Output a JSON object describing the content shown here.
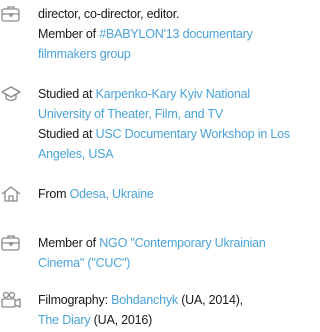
{
  "colors": {
    "text": "#1a1a1a",
    "link": "#4aa3d8",
    "icon": "#8a8a8a"
  },
  "sections": [
    {
      "icon": "briefcase-icon",
      "lines": [
        [
          {
            "text": "director, co-director, editor."
          }
        ],
        [
          {
            "text": "Member of "
          },
          {
            "text": "#BABYLON'13 documentary",
            "link": true
          }
        ],
        [
          {
            "text": "filmmakers group",
            "link": true
          }
        ]
      ]
    },
    {
      "icon": "graduation-cap-icon",
      "lines": [
        [
          {
            "text": "Studied at "
          },
          {
            "text": "Karpenko-Kary Kyiv National",
            "link": true
          }
        ],
        [
          {
            "text": "University of Theater, Film, and TV",
            "link": true
          }
        ],
        [
          {
            "text": "Studied at "
          },
          {
            "text": "USC Documentary Workshop in Los",
            "link": true
          }
        ],
        [
          {
            "text": "Angeles, USA",
            "link": true
          }
        ]
      ]
    },
    {
      "icon": "home-icon",
      "lines": [
        [
          {
            "text": "From "
          },
          {
            "text": "Odesa, Ukraine",
            "link": true
          }
        ]
      ]
    },
    {
      "icon": "briefcase-icon",
      "lines": [
        [
          {
            "text": "Member of "
          },
          {
            "text": "NGO \"Contemporary Ukrainian",
            "link": true
          }
        ],
        [
          {
            "text": "Cinema\" (\"CUC\")",
            "link": true
          }
        ]
      ]
    },
    {
      "icon": "film-camera-icon",
      "lines": [
        [
          {
            "text": "Filmography: "
          },
          {
            "text": "Bohdanchyk",
            "link": true
          },
          {
            "text": " (UA, 2014),"
          }
        ],
        [
          {
            "text": "The Diary",
            "link": true
          },
          {
            "text": " (UA, 2016)"
          }
        ]
      ]
    }
  ]
}
